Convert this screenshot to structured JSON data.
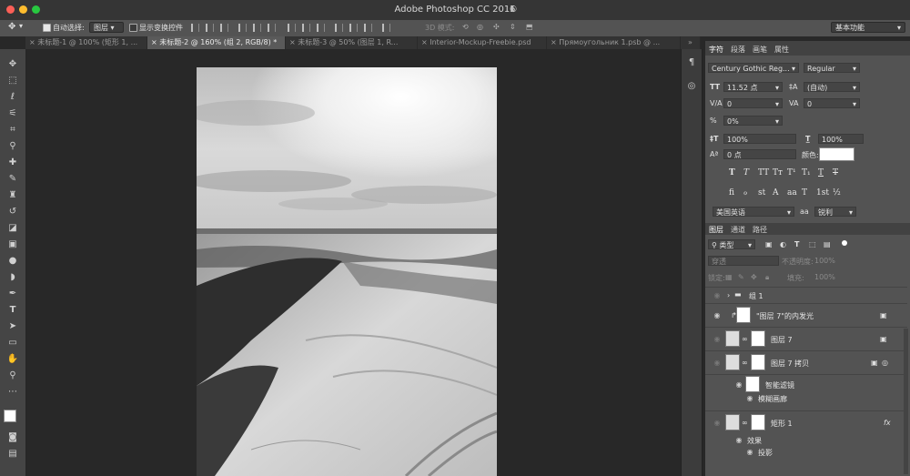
{
  "window": {
    "title": "Adobe Photoshop CC 2015"
  },
  "options_bar": {
    "auto_select_label": "自动选择:",
    "auto_select_value": "图层",
    "show_transform_label": "显示变换控件",
    "mode3d_label": "3D 模式:",
    "workspace_value": "基本功能"
  },
  "tabs": [
    {
      "label": "未标题-1 @ 100% (矩形 1, ..."
    },
    {
      "label": "未标题-2 @ 160% (组 2, RGB/8) *"
    },
    {
      "label": "未标题-3 @ 50% (图层 1, R..."
    },
    {
      "label": "Interior-Mockup-Freebie.psd"
    },
    {
      "label": "Прямоугольник 1.psb @ ..."
    }
  ],
  "character_panel": {
    "tabs": [
      "字符",
      "段落",
      "画笔",
      "属性"
    ],
    "font_family": "Century Gothic Reg...",
    "font_style": "Regular",
    "font_size": "11.52 点",
    "leading": "(自动)",
    "kerning": "0",
    "tracking": "0",
    "tsume": "0%",
    "vertical_scale": "100%",
    "horizontal_scale": "100%",
    "baseline_shift": "0 点",
    "color_label": "颜色:",
    "color": "#ffffff",
    "type_buttons": [
      "T",
      "T",
      "TT",
      "Tт",
      "T¹",
      "T₁",
      "T",
      "T"
    ],
    "opentype_buttons": [
      "fi",
      "ℴ",
      "st",
      "A",
      "aa",
      "T",
      "1st",
      "½"
    ],
    "language": "美国英语",
    "aa_label": "aa",
    "antialias": "锐利"
  },
  "layers_panel": {
    "tabs": [
      "图层",
      "通道",
      "路径"
    ],
    "filter": "类型",
    "blend_mode": "穿透",
    "opacity_label": "不透明度:",
    "opacity": "100%",
    "lock_label": "锁定:",
    "fill_label": "填充:",
    "fill": "100%",
    "layers": [
      {
        "name": "组 1"
      },
      {
        "name": "\"图层 7\"的内发光"
      },
      {
        "name": "图层 7"
      },
      {
        "name": "图层 7 拷贝"
      },
      {
        "name": "智能滤镜"
      },
      {
        "name": "模糊画廊"
      },
      {
        "name": "矩形 1"
      },
      {
        "name": "效果"
      },
      {
        "name": "投影"
      }
    ]
  }
}
